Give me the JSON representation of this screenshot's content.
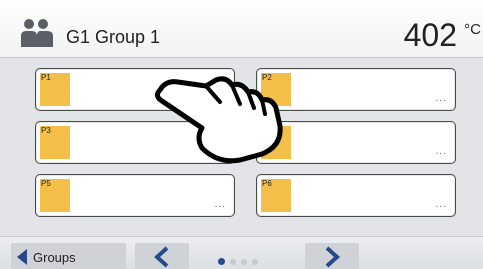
{
  "header": {
    "title": "G1 Group 1",
    "temperature": "402",
    "temperature_unit": "°C",
    "icon": "group-icon"
  },
  "programs": [
    {
      "label": "P1",
      "more": "..."
    },
    {
      "label": "P2",
      "more": "..."
    },
    {
      "label": "P3",
      "more": "..."
    },
    {
      "label": "",
      "more": "..."
    },
    {
      "label": "P5",
      "more": "..."
    },
    {
      "label": "P6",
      "more": "..."
    }
  ],
  "footer": {
    "groups_label": "Groups",
    "prev_icon": "chevron-left-icon",
    "next_icon": "chevron-right-icon",
    "page_count": 4,
    "active_page": 1
  },
  "overlay": {
    "icon": "pointing-hand-icon"
  },
  "colors": {
    "accent": "#26498a",
    "program_swatch": "#f3bf49",
    "icon_gray": "#5a5f66"
  }
}
